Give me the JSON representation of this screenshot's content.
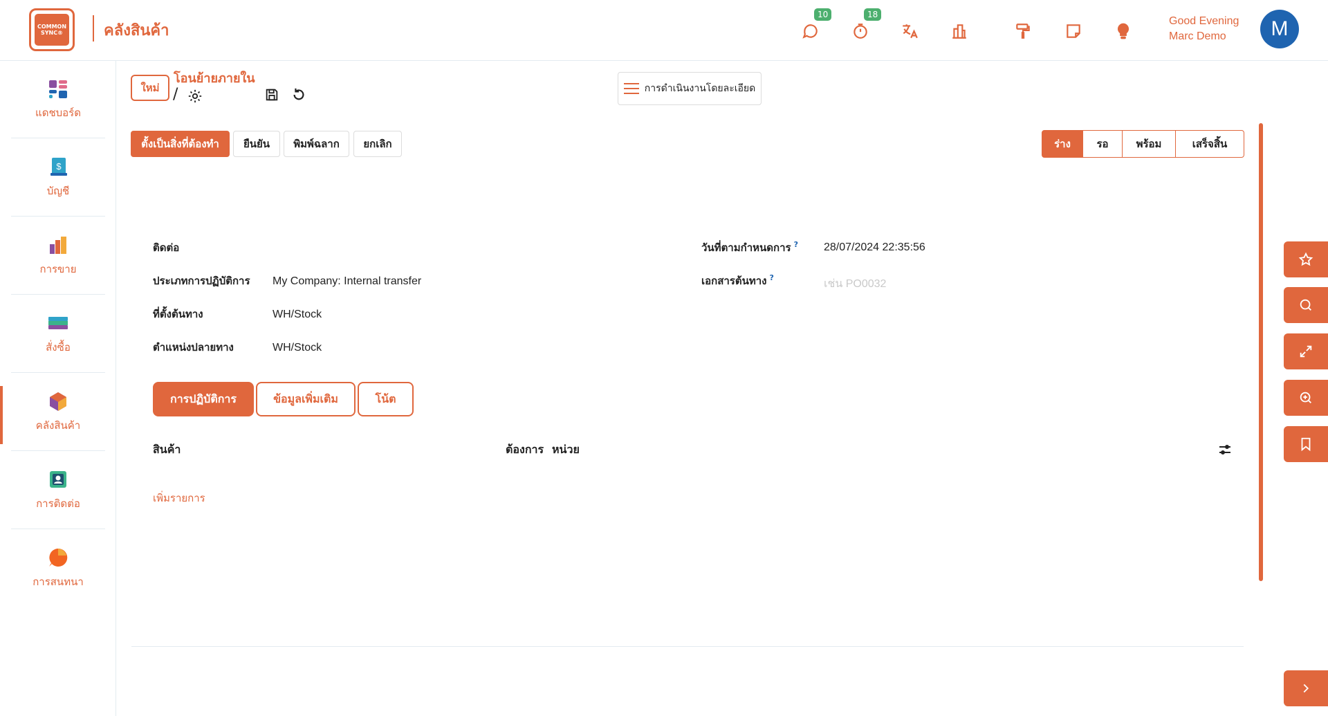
{
  "header": {
    "app_title": "คลังสินค้า",
    "logo_line1": "COMMON",
    "logo_line2": "SYNC®",
    "messages_badge": "10",
    "activity_badge": "18",
    "greeting": "Good Evening",
    "user_name": "Marc Demo",
    "avatar_letter": "M",
    "icons": [
      "chat-icon",
      "timer-icon",
      "translate-icon",
      "building-icon",
      "paint-roller-icon",
      "note-icon",
      "lightbulb-icon"
    ]
  },
  "sidebar": {
    "items": [
      {
        "label": "แดชบอร์ด",
        "icon": "dashboard-icon"
      },
      {
        "label": "บัญชี",
        "icon": "accounting-icon"
      },
      {
        "label": "การขาย",
        "icon": "sales-icon"
      },
      {
        "label": "สั่งซื้อ",
        "icon": "purchase-icon"
      },
      {
        "label": "คลังสินค้า",
        "icon": "inventory-icon"
      },
      {
        "label": "การติดต่อ",
        "icon": "contacts-icon"
      },
      {
        "label": "การสนทนา",
        "icon": "discuss-icon"
      }
    ],
    "active_index": 4
  },
  "breadcrumb": {
    "new_label": "ใหม่",
    "title": "โอนย้ายภายใน",
    "separator": "/"
  },
  "detail_button": "การดำเนินงานโดยละเอียด",
  "actions": {
    "todo": "ตั้งเป็นสิ่งที่ต้องทำ",
    "confirm": "ยืนยัน",
    "print_label": "พิมพ์ฉลาก",
    "cancel": "ยกเลิก"
  },
  "statusbar": {
    "states": [
      "ร่าง",
      "รอ",
      "พร้อม",
      "เสร็จสิ้น"
    ],
    "active": "ร่าง"
  },
  "form": {
    "contact_label": "ติดต่อ",
    "contact_value": "",
    "operation_type_label": "ประเภทการปฏิบัติการ",
    "operation_type_value": "My Company: Internal transfer",
    "source_location_label": "ที่ตั้งต้นทาง",
    "source_location_value": "WH/Stock",
    "dest_location_label": "ตำแหน่งปลายทาง",
    "dest_location_value": "WH/Stock",
    "scheduled_date_label": "วันที่ตามกำหนดการ",
    "scheduled_date_value": "28/07/2024 22:35:56",
    "source_doc_label": "เอกสารต้นทาง",
    "source_doc_placeholder": "เช่น PO0032",
    "help_mark": "?"
  },
  "tabs": {
    "operations": "การปฏิบัติการ",
    "additional_info": "ข้อมูลเพิ่มเติม",
    "note": "โน้ต"
  },
  "table": {
    "product_header": "สินค้า",
    "demand_header": "ต้องการ",
    "unit_header": "หน่วย",
    "add_line": "เพิ่มรายการ"
  },
  "colors": {
    "accent": "#e0673d",
    "avatar": "#1f64b0",
    "badge": "#4caf6e"
  }
}
